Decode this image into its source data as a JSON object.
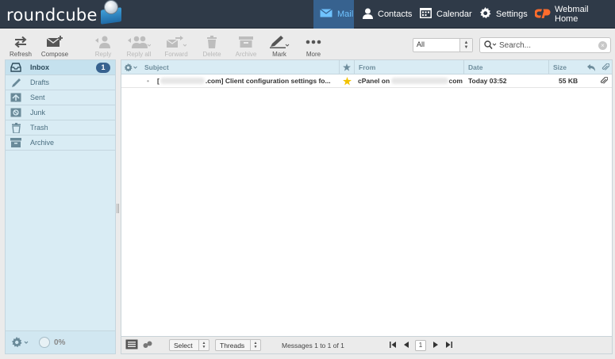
{
  "app": {
    "logo_text": "roundcube"
  },
  "topnav": [
    {
      "label": "Mail",
      "icon": "mail-icon",
      "active": true
    },
    {
      "label": "Contacts",
      "icon": "contacts-icon"
    },
    {
      "label": "Calendar",
      "icon": "calendar-icon"
    },
    {
      "label": "Settings",
      "icon": "settings-icon"
    },
    {
      "label": "Webmail Home",
      "icon": "cpanel-logo-icon"
    }
  ],
  "toolbar": {
    "refresh": "Refresh",
    "compose": "Compose",
    "reply": "Reply",
    "reply_all": "Reply all",
    "forward": "Forward",
    "delete": "Delete",
    "archive": "Archive",
    "mark": "Mark",
    "more": "More"
  },
  "filter": {
    "selected": "All"
  },
  "search": {
    "placeholder": "Search..."
  },
  "folders": [
    {
      "label": "Inbox",
      "icon": "inbox-icon",
      "unread": "1",
      "selected": true
    },
    {
      "label": "Drafts",
      "icon": "pencil-icon"
    },
    {
      "label": "Sent",
      "icon": "sent-icon"
    },
    {
      "label": "Junk",
      "icon": "junk-icon"
    },
    {
      "label": "Trash",
      "icon": "trash-icon"
    },
    {
      "label": "Archive",
      "icon": "archive-icon"
    }
  ],
  "quota": {
    "label": "0%",
    "value": 0
  },
  "list": {
    "columns": {
      "subject": "Subject",
      "from": "From",
      "date": "Date",
      "size": "Size"
    },
    "messages": [
      {
        "subject_suffix": ".com] Client configuration settings fo...",
        "subject_prefix": "[",
        "from_prefix": "cPanel on",
        "from_suffix": "com",
        "date": "Today 03:52",
        "size": "55 KB",
        "flagged": true,
        "has_attachment": true
      }
    ]
  },
  "footer": {
    "select": "Select",
    "threads": "Threads",
    "count": "Messages 1 to 1 of 1",
    "page": "1"
  },
  "colors": {
    "topbar": "#2f3a48",
    "accent": "#37628f",
    "panel": "#d9ecf4",
    "flag_star": "#f2c200"
  }
}
